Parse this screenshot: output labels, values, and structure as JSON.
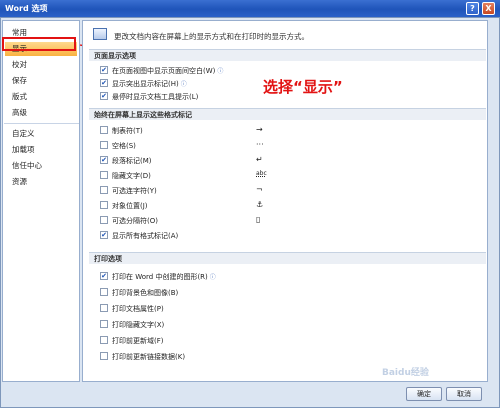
{
  "window": {
    "title": "Word 选项",
    "help": "?",
    "close": "X"
  },
  "sidebar": {
    "items": [
      {
        "label": "常用"
      },
      {
        "label": "显示"
      },
      {
        "label": "校对"
      },
      {
        "label": "保存"
      },
      {
        "label": "版式"
      },
      {
        "label": "高级"
      },
      {
        "label": "自定义"
      },
      {
        "label": "加载项"
      },
      {
        "label": "信任中心"
      },
      {
        "label": "资源"
      }
    ],
    "selected": "显示"
  },
  "content": {
    "header": "更改文档内容在屏幕上的显示方式和在打印时的显示方式。",
    "sections": [
      {
        "title": "页面显示选项",
        "options": [
          {
            "label": "在页面视图中显示页面间空白(W)",
            "checked": true,
            "info": "ⓘ"
          },
          {
            "label": "显示突出显示标记(H)",
            "checked": true,
            "info": "ⓘ"
          },
          {
            "label": "悬停时显示文档工具提示(L)",
            "checked": true,
            "info": ""
          }
        ]
      },
      {
        "title": "始终在屏幕上显示这些格式标记",
        "options": [
          {
            "label": "制表符(T)",
            "checked": false,
            "mark": "→"
          },
          {
            "label": "空格(S)",
            "checked": false,
            "mark": "···"
          },
          {
            "label": "段落标记(M)",
            "checked": true,
            "mark": "↵"
          },
          {
            "label": "隐藏文字(D)",
            "checked": false,
            "mark": "abc"
          },
          {
            "label": "可选连字符(Y)",
            "checked": false,
            "mark": "¬"
          },
          {
            "label": "对象位置(J)",
            "checked": false,
            "mark": "⚓"
          },
          {
            "label": "可选分隔符(O)",
            "checked": false,
            "mark": "▯"
          },
          {
            "label": "显示所有格式标记(A)",
            "checked": true,
            "mark": ""
          }
        ]
      },
      {
        "title": "打印选项",
        "options": [
          {
            "label": "打印在 Word 中创建的图形(R)",
            "checked": true,
            "info": "ⓘ"
          },
          {
            "label": "打印背景色和图像(B)",
            "checked": false,
            "info": ""
          },
          {
            "label": "打印文档属性(P)",
            "checked": false,
            "info": ""
          },
          {
            "label": "打印隐藏文字(X)",
            "checked": false,
            "info": ""
          },
          {
            "label": "打印前更新域(F)",
            "checked": false,
            "info": ""
          },
          {
            "label": "打印前更新链接数据(K)",
            "checked": false,
            "info": ""
          }
        ]
      }
    ]
  },
  "annotation": "选择“显示”",
  "footer": {
    "ok": "确定",
    "cancel": "取消"
  },
  "watermark": "Baidu经验",
  "colors": {
    "annotation_red": "#e21313",
    "selected_bg": "#f9b241",
    "titlebar": "#1f54b9"
  }
}
